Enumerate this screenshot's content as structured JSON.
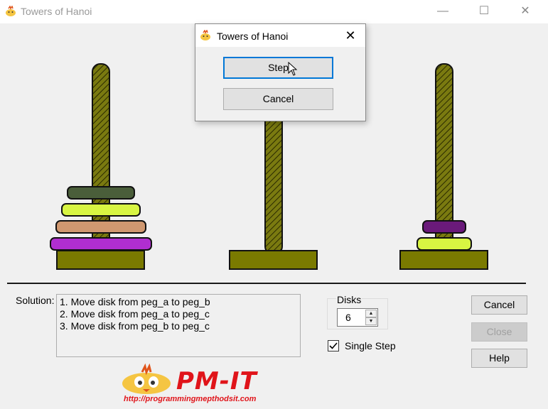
{
  "window": {
    "title": "Towers of Hanoi",
    "controls": {
      "minimize": "—",
      "maximize": "☐",
      "close": "✕"
    }
  },
  "pegs": {
    "peg_a": {
      "disks": [
        "#4a5e3a",
        "#d8f542",
        "#d09870",
        "#b02ed0"
      ]
    },
    "peg_b": {
      "disks": []
    },
    "peg_c": {
      "disks": [
        "#6a1a7a",
        "#d8f542"
      ]
    },
    "colors": {
      "rod": "#7a7a10",
      "base": "#7a7a00"
    }
  },
  "solution": {
    "label": "Solution:",
    "lines": [
      "1. Move disk from peg_a to peg_b",
      "2. Move disk from peg_a to peg_c",
      "3. Move disk from peg_b to peg_c"
    ]
  },
  "disks": {
    "label": "Disks",
    "value": "6"
  },
  "single_step": {
    "label": "Single Step",
    "checked": true
  },
  "buttons": {
    "cancel": "Cancel",
    "close": "Close",
    "help": "Help"
  },
  "logo": {
    "text": "PM-IT",
    "url": "http://programmingmepthodsit.com"
  },
  "dialog": {
    "title": "Towers of Hanoi",
    "close": "✕",
    "step": "Step",
    "cancel": "Cancel"
  }
}
